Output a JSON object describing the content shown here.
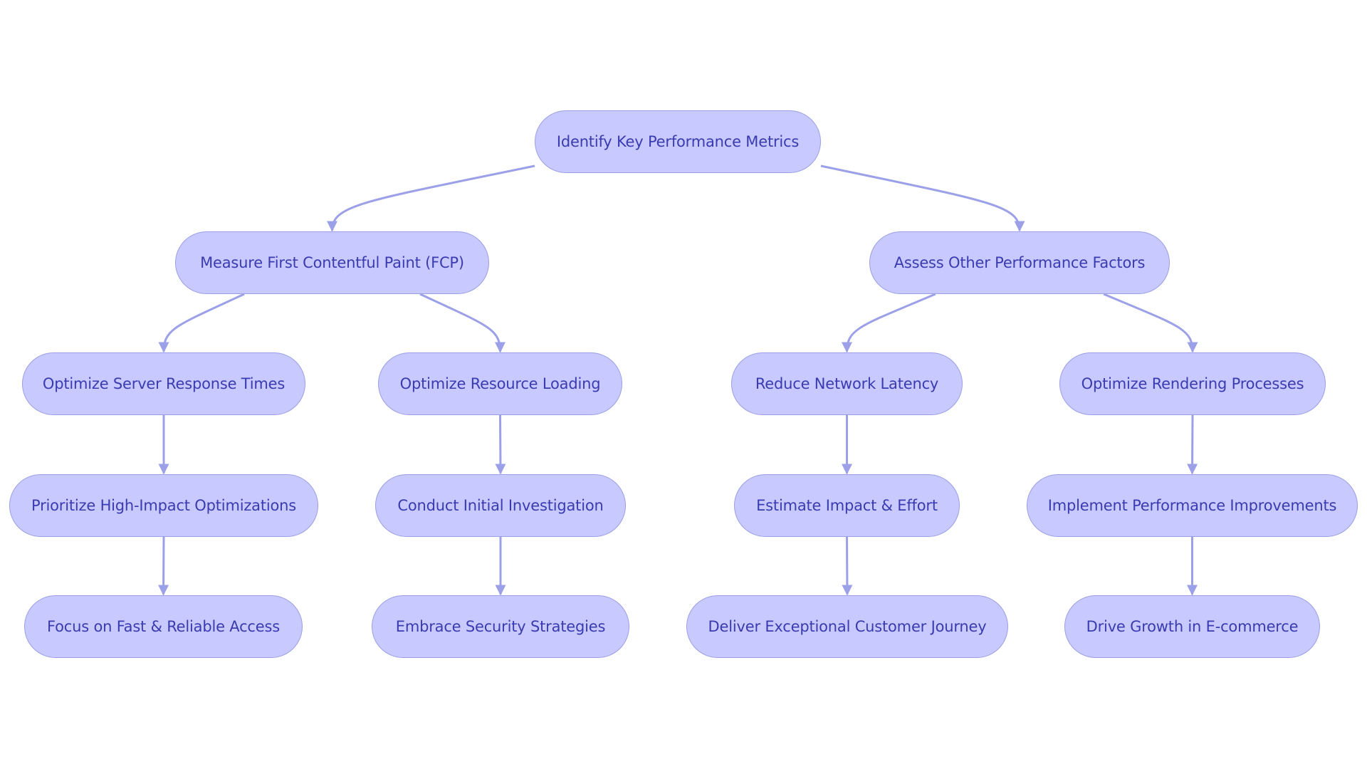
{
  "colors": {
    "node_fill": "#c8caff",
    "node_border": "#9a9ee6",
    "text": "#3a3bb0",
    "edge": "#9ca0e8"
  },
  "nodes": {
    "root": "Identify Key Performance Metrics",
    "fcp": "Measure First Contentful Paint (FCP)",
    "other": "Assess Other Performance Factors",
    "server": "Optimize Server Response Times",
    "resource": "Optimize Resource Loading",
    "latency": "Reduce Network Latency",
    "rendering": "Optimize Rendering Processes",
    "prioritize": "Prioritize High-Impact Optimizations",
    "investigate": "Conduct Initial Investigation",
    "estimate": "Estimate Impact & Effort",
    "implement": "Implement Performance Improvements",
    "focus": "Focus on Fast & Reliable Access",
    "security": "Embrace Security Strategies",
    "journey": "Deliver Exceptional Customer Journey",
    "growth": "Drive Growth in E-commerce"
  },
  "edges": [
    [
      "root",
      "fcp"
    ],
    [
      "root",
      "other"
    ],
    [
      "fcp",
      "server"
    ],
    [
      "fcp",
      "resource"
    ],
    [
      "other",
      "latency"
    ],
    [
      "other",
      "rendering"
    ],
    [
      "server",
      "prioritize"
    ],
    [
      "prioritize",
      "focus"
    ],
    [
      "resource",
      "investigate"
    ],
    [
      "investigate",
      "security"
    ],
    [
      "latency",
      "estimate"
    ],
    [
      "estimate",
      "journey"
    ],
    [
      "rendering",
      "implement"
    ],
    [
      "implement",
      "growth"
    ]
  ]
}
